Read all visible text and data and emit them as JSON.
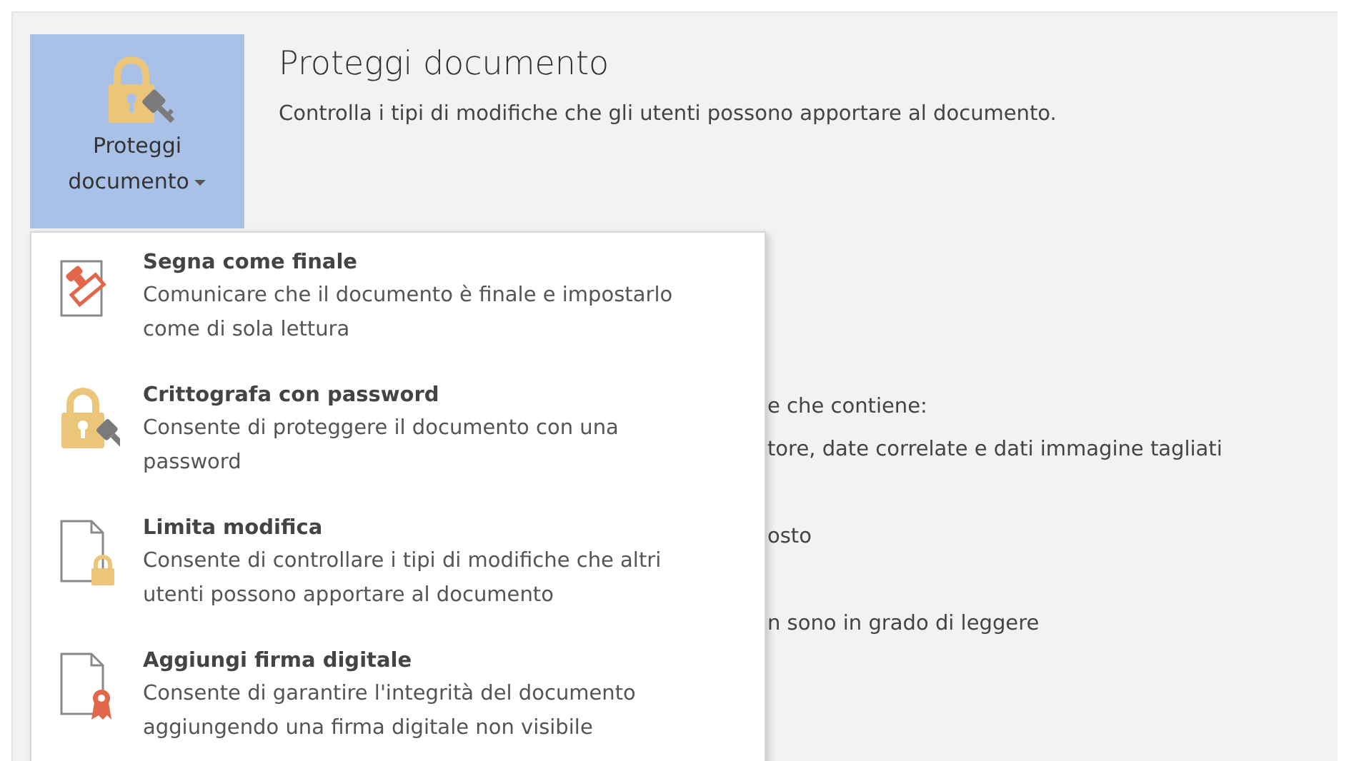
{
  "protect_button": {
    "label": "Proteggi documento",
    "selected": true
  },
  "section": {
    "title": "Proteggi documento",
    "description": "Controlla i tipi di modifiche che gli utenti possono apportare al documento."
  },
  "background_lines": [
    "e che contiene:",
    "tore, date correlate e dati immagine tagliati",
    "osto",
    "n sono in grado di leggere"
  ],
  "menu_items": [
    {
      "kind": "final",
      "title": "Segna come finale",
      "description": "Comunicare che il documento è finale e impostarlo come di sola lettura"
    },
    {
      "kind": "encrypt",
      "title": "Crittografa con password",
      "description": "Consente di proteggere il documento con una password"
    },
    {
      "kind": "restrict",
      "title": "Limita modifica",
      "description": "Consente di controllare i tipi di modifiche che altri utenti possono apportare al documento"
    },
    {
      "kind": "signature",
      "title": "Aggiungi firma digitale",
      "description": "Consente di garantire l'integrità del documento aggiungendo una firma digitale non visibile"
    }
  ]
}
